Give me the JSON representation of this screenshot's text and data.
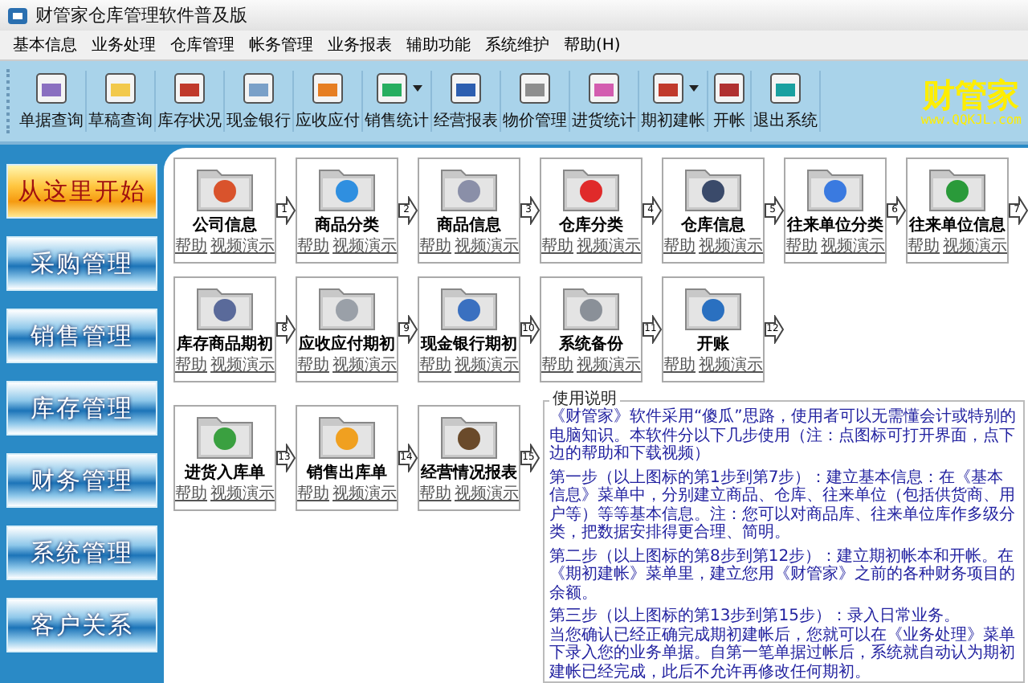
{
  "window": {
    "title": "财管家仓库管理软件普及版"
  },
  "menu": [
    "基本信息",
    "业务处理",
    "仓库管理",
    "帐务管理",
    "业务报表",
    "辅助功能",
    "系统维护",
    "帮助(H)"
  ],
  "toolbar": [
    {
      "label": "单据查询",
      "dropdown": false
    },
    {
      "label": "草稿查询",
      "dropdown": false
    },
    {
      "label": "库存状况",
      "dropdown": false
    },
    {
      "label": "现金银行",
      "dropdown": false
    },
    {
      "label": "应收应付",
      "dropdown": false
    },
    {
      "label": "销售统计",
      "dropdown": true
    },
    {
      "label": "经营报表",
      "dropdown": false
    },
    {
      "label": "物价管理",
      "dropdown": false
    },
    {
      "label": "进货统计",
      "dropdown": false
    },
    {
      "label": "期初建帐",
      "dropdown": true
    },
    {
      "label": "开帐",
      "dropdown": false
    },
    {
      "label": "退出系统",
      "dropdown": false
    }
  ],
  "logo": {
    "name": "财管家",
    "url": "www.QQKJL.com"
  },
  "sidebar": {
    "items": [
      {
        "label": "从这里开始",
        "selected": true
      },
      {
        "label": "采购管理",
        "selected": false
      },
      {
        "label": "销售管理",
        "selected": false
      },
      {
        "label": "库存管理",
        "selected": false
      },
      {
        "label": "财务管理",
        "selected": false
      },
      {
        "label": "系统管理",
        "selected": false
      },
      {
        "label": "客户关系",
        "selected": false
      }
    ]
  },
  "rows": [
    [
      {
        "name": "公司信息",
        "help": "帮助",
        "video": "视频演示",
        "step": "1"
      },
      {
        "name": "商品分类",
        "help": "帮助",
        "video": "视频演示",
        "step": "2"
      },
      {
        "name": "商品信息",
        "help": "帮助",
        "video": "视频演示",
        "step": "3"
      },
      {
        "name": "仓库分类",
        "help": "帮助",
        "video": "视频演示",
        "step": "4"
      },
      {
        "name": "仓库信息",
        "help": "帮助",
        "video": "视频演示",
        "step": "5"
      },
      {
        "name": "往来单位分类",
        "help": "帮助",
        "video": "视频演示",
        "step": "6"
      },
      {
        "name": "往来单位信息",
        "help": "帮助",
        "video": "视频演示",
        "step": "7"
      }
    ],
    [
      {
        "name": "库存商品期初",
        "help": "帮助",
        "video": "视频演示",
        "step": "8"
      },
      {
        "name": "应收应付期初",
        "help": "帮助",
        "video": "视频演示",
        "step": "9"
      },
      {
        "name": "现金银行期初",
        "help": "帮助",
        "video": "视频演示",
        "step": "10"
      },
      {
        "name": "系统备份",
        "help": "帮助",
        "video": "视频演示",
        "step": "11"
      },
      {
        "name": "开账",
        "help": "帮助",
        "video": "视频演示",
        "step": "12"
      }
    ],
    [
      {
        "name": "进货入库单",
        "help": "帮助",
        "video": "视频演示",
        "step": "13"
      },
      {
        "name": "销售出库单",
        "help": "帮助",
        "video": "视频演示",
        "step": "14"
      },
      {
        "name": "经营情况报表",
        "help": "帮助",
        "video": "视频演示",
        "step": "15"
      }
    ]
  ],
  "instructions": {
    "title": "使用说明",
    "paragraphs": [
      [
        "《财管家》软件采用“傻瓜”思路，使用者可以无需懂会计或特别的电脑知识。本软件分以下几步使用（注：点图标可打开界面，点下边的帮助和下载视频）"
      ],
      [
        "第一步（以上图标的第1步到第7步）：建立基本信息：在《基本信息》菜单中，分别建立商品、仓库、往来单位（包括供货商、用户等）等等基本信息。注：您可以对商品库、往来单位库作多级分类，把数据安排得更合理、简明。"
      ],
      [
        "第二步（以上图标的第8步到第12步）：建立期初帐本和开帐。在《期初建帐》菜单里，建立您用《财管家》之前的各种财务项目的余额。"
      ],
      [
        "第三步（以上图标的第13步到第15步）：录入日常业务。",
        "当您确认已经正确完成期初建帐后，您就可以在《业务处理》菜单下录入您的业务单据。自第一笔单据过帐后，系统就自动认为期初建帐已经完成，此后不允许再修改任何期初。"
      ]
    ]
  }
}
